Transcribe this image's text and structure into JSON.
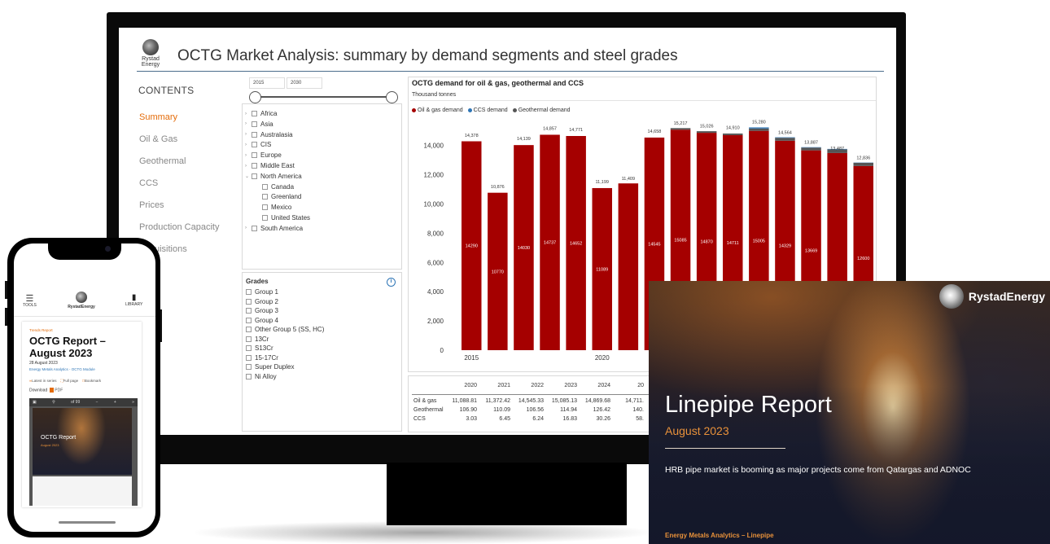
{
  "dashboard": {
    "logo_text": "Rystad\nEnergy",
    "title": "OCTG Market Analysis: summary by demand segments and steel grades",
    "contents_heading": "CONTENTS",
    "nav": [
      {
        "label": "Summary",
        "active": true
      },
      {
        "label": "Oil & Gas",
        "active": false
      },
      {
        "label": "Geothermal",
        "active": false
      },
      {
        "label": "CCS",
        "active": false
      },
      {
        "label": "Prices",
        "active": false
      },
      {
        "label": "Production Capacity",
        "active": false
      },
      {
        "label": "Acquisitions",
        "active": false
      }
    ],
    "year_range": {
      "from": "2015",
      "to": "2030"
    },
    "regions": [
      {
        "label": "Africa",
        "expander": "›"
      },
      {
        "label": "Asia",
        "expander": "›"
      },
      {
        "label": "Australasia",
        "expander": "›"
      },
      {
        "label": "CIS",
        "expander": "›"
      },
      {
        "label": "Europe",
        "expander": "›"
      },
      {
        "label": "Middle East",
        "expander": "›"
      },
      {
        "label": "North America",
        "expander": "⌄"
      },
      {
        "label": "Canada",
        "expander": ""
      },
      {
        "label": "Greenland",
        "expander": ""
      },
      {
        "label": "Mexico",
        "expander": ""
      },
      {
        "label": "United States",
        "expander": ""
      },
      {
        "label": "South America",
        "expander": "›"
      }
    ],
    "grades_heading": "Grades",
    "grades": [
      "Group 1",
      "Group 2",
      "Group 3",
      "Group 4",
      "Other Group 5 (SS, HC)",
      "13Cr",
      "S13Cr",
      "15-17Cr",
      "Super Duplex",
      "Ni Alloy"
    ],
    "chart_title": "OCTG demand for oil & gas, geothermal and CCS",
    "chart_subtitle": "Thousand tonnes",
    "legend": [
      {
        "label": "Oil & gas demand",
        "color": "#a50000"
      },
      {
        "label": "CCS demand",
        "color": "#2e75b6"
      },
      {
        "label": "Geothermal demand",
        "color": "#555555"
      }
    ],
    "table": {
      "years": [
        "2020",
        "2021",
        "2022",
        "2023",
        "2024",
        "20"
      ],
      "rows": [
        {
          "label": "Oil & gas",
          "values": [
            "11,088.81",
            "11,372.42",
            "14,545.33",
            "15,085.13",
            "14,869.68",
            "14,711."
          ]
        },
        {
          "label": "Geothermal",
          "values": [
            "106.90",
            "110.09",
            "106.56",
            "114.94",
            "126.42",
            "140."
          ]
        },
        {
          "label": "CCS",
          "values": [
            "3.03",
            "6.45",
            "6.24",
            "16.83",
            "30.26",
            "58."
          ]
        }
      ]
    }
  },
  "chart_data": {
    "type": "bar",
    "title": "OCTG demand for oil & gas, geothermal and CCS",
    "subtitle": "Thousand tonnes",
    "y_ticks": [
      "0",
      "2,000",
      "4,000",
      "6,000",
      "8,000",
      "10,000",
      "12,000",
      "14,000"
    ],
    "ylim": [
      0,
      16000
    ],
    "x_tick_labels": [
      {
        "index": 0,
        "label": "2015"
      },
      {
        "index": 5,
        "label": "2020"
      }
    ],
    "series": [
      {
        "name": "Oil & gas demand",
        "color": "#a50000",
        "values": [
          14290,
          10770,
          14030,
          14737,
          14652,
          11089,
          null,
          14545,
          15085,
          14870,
          14711,
          15005,
          14329,
          13669,
          null,
          12600
        ]
      },
      {
        "name": "Geothermal demand",
        "color": "#555555",
        "values": [
          null,
          null,
          null,
          null,
          null,
          null,
          null,
          null,
          105,
          110,
          110,
          160,
          200,
          190,
          250,
          220
        ]
      },
      {
        "name": "CCS demand",
        "color": "#2e75b6",
        "values": [
          null,
          null,
          null,
          null,
          null,
          null,
          null,
          null,
          null,
          null,
          null,
          75,
          35,
          28,
          30,
          16
        ]
      }
    ],
    "totals": [
      14378,
      10876,
      14139,
      14857,
      14771,
      11199,
      11409,
      14658,
      15217,
      15026,
      14910,
      15280,
      14564,
      13887,
      13487,
      12836
    ],
    "total_labels": [
      "14,378",
      "10,876",
      "14,139",
      "14,857",
      "14,771",
      "11,199",
      "11,409",
      "14,658",
      "15,217",
      "15,026",
      "14,910",
      "15,280",
      "14,564",
      "13,887",
      "13,487",
      "12,836"
    ],
    "inner_labels": [
      "14290",
      "10770",
      "14030",
      "14737",
      "14652",
      "11089",
      "",
      "14545",
      "15085",
      "14870",
      "14711",
      "15005",
      "14329",
      "13669",
      "",
      "12600"
    ]
  },
  "report": {
    "brand": "RystadEnergy",
    "title": "Linepipe Report",
    "date": "August 2023",
    "description": "HRB pipe market is booming as major projects come from Qatargas and ADNOC",
    "footer": "Energy Metals Analytics – Linepipe"
  },
  "phone": {
    "tools_label": "TOOLS",
    "brand": "RystadEnergy",
    "library_label": "LIBRARY",
    "tag": "Trends Report",
    "title": "OCTG Report – August 2023",
    "date": "28 August 2023",
    "module_link": "Energy Metals Analytics - OCTG Module",
    "meta": [
      "Latest in series",
      "Full page",
      "Bookmark"
    ],
    "download_label": "Download",
    "pdf_label": "PDF",
    "page_indicator": "of 99",
    "viewer_title": "OCTG Report",
    "viewer_date": "August 2023"
  }
}
